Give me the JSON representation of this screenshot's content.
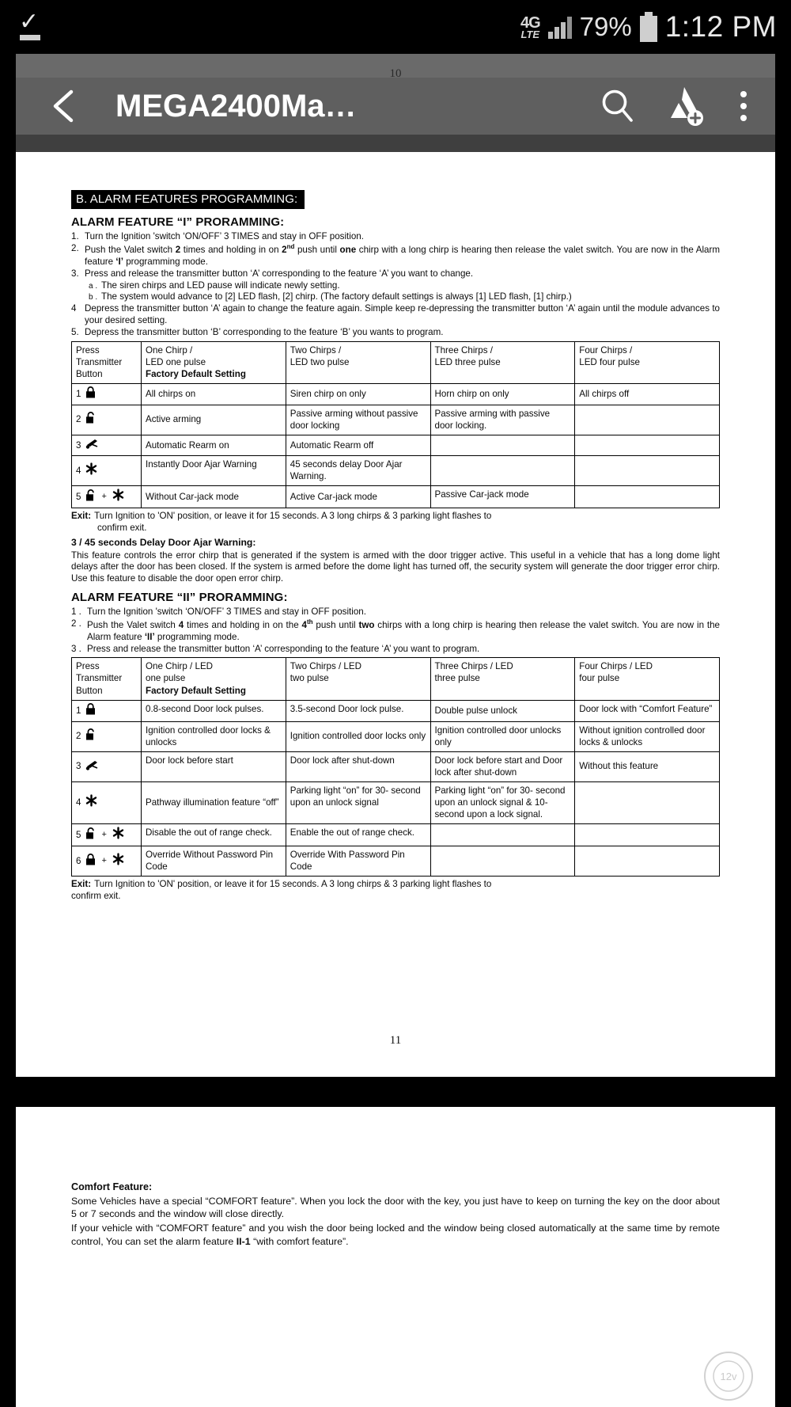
{
  "statusbar": {
    "download_icon": "download-complete-icon",
    "network_type_line1": "4G",
    "network_type_line2": "LTE",
    "signal_icon": "signal-bars-icon",
    "battery_percent": "79%",
    "battery_icon": "battery-icon",
    "time": "1:12 PM"
  },
  "appbar": {
    "back_icon": "back-arrow-icon",
    "title": "MEGA2400Ma…",
    "search_icon": "search-icon",
    "add_to_drive_icon": "drive-add-icon",
    "overflow_icon": "more-options-icon",
    "page_indicator": "10"
  },
  "doc": {
    "section_band": "B. ALARM FEATURES PROGRAMMING:",
    "feature1": {
      "heading": "ALARM FEATURE “I” PRORAMMING:",
      "steps": [
        {
          "num": "1.",
          "text": "Turn the Ignition 'switch ‘ON/OFF’ 3 TIMES and stay in OFF position."
        },
        {
          "num": "2.",
          "text_a": "Push the Valet switch ",
          "bold_a": "2",
          "text_b": " times and holding in on ",
          "bold_b": "2",
          "sup_b": "nd",
          "text_c": " push until ",
          "bold_c": "one",
          "text_d": " chirp with a long chirp is hearing then release the valet switch. You are now in the Alarm feature ",
          "bold_d": "‘I’",
          "text_e": " programming mode."
        },
        {
          "num": "3.",
          "text": "Press and release the transmitter button ‘A’ corresponding to the feature ‘A’ you want to change."
        }
      ],
      "substeps": [
        {
          "num": "a .",
          "text": "The siren chirps and LED pause will indicate newly setting."
        },
        {
          "num": "b .",
          "text": "The system would advance to [2] LED flash, [2] chirp. (The factory default settings is always [1] LED flash, [1] chirp.)"
        }
      ],
      "steps2": [
        {
          "num": "4",
          "text": "Depress the transmitter button ‘A’ again to change the feature again. Simple keep re-depressing the transmitter button ‘A’ again until the module advances to your desired setting."
        },
        {
          "num": "5.",
          "text": "Depress the transmitter button ‘B’ corresponding to the feature ‘B’ you wants to program."
        }
      ],
      "table": {
        "headers": [
          {
            "l1": "Press",
            "l2": "Transmitter",
            "l3": "Button",
            "bold3": ""
          },
          {
            "l1": "One Chirp /",
            "l2": "LED one pulse",
            "l3": "Factory Default Setting",
            "bold3": "yes"
          },
          {
            "l1": "Two Chirps /",
            "l2": "LED two pulse",
            "l3": "",
            "bold3": ""
          },
          {
            "l1": "Three Chirps /",
            "l2": "LED three pulse",
            "l3": "",
            "bold3": ""
          },
          {
            "l1": "Four Chirps /",
            "l2": "LED four pulse",
            "l3": "",
            "bold3": ""
          }
        ],
        "rows": [
          {
            "num": "1",
            "icons": [
              "lock"
            ],
            "cells": [
              "All chirps on",
              "Siren chirp on only",
              "Horn chirp on only",
              "All chirps off"
            ]
          },
          {
            "num": "2",
            "icons": [
              "unlock"
            ],
            "cells": [
              "Active arming",
              "Passive arming without passive door locking",
              "Passive arming with passive door locking.",
              ""
            ]
          },
          {
            "num": "3",
            "icons": [
              "trunk"
            ],
            "cells": [
              "Automatic Rearm on",
              "Automatic Rearm off",
              "",
              ""
            ]
          },
          {
            "num": "4",
            "icons": [
              "star"
            ],
            "cells": [
              "Instantly Door Ajar Warning",
              "45 seconds delay Door Ajar Warning.",
              "",
              ""
            ]
          },
          {
            "num": "5",
            "icons": [
              "unlock",
              "plus",
              "star"
            ],
            "cells": [
              "Without Car-jack mode",
              "Active Car-jack mode",
              "Passive Car-jack mode",
              ""
            ]
          }
        ]
      },
      "exit_label": "Exit:",
      "exit_text": "Turn Ignition to 'ON' position, or leave it for 15 seconds. A 3 long chirps & 3 parking light flashes to",
      "exit_text2": "confirm exit.",
      "note_heading": "3 / 45 seconds Delay Door Ajar Warning:",
      "note_body": "This feature controls the error chirp that is generated if the system is armed with the door trigger active. This useful in a vehicle that has a long dome light delays after the door has been closed. If the system is armed before the dome light has turned off, the security system will generate the door trigger error chirp. Use this feature to disable the door open error chirp."
    },
    "feature2": {
      "heading": "ALARM FEATURE “II” PRORAMMING:",
      "steps": [
        {
          "num": "1 .",
          "text": "Turn the Ignition 'switch ‘ON/OFF’ 3 TIMES and stay in OFF position."
        },
        {
          "num": "2 .",
          "text_a": "Push the Valet switch ",
          "bold_a": "4",
          "text_b": " times and holding in on the ",
          "bold_b": "4",
          "sup_b": "th",
          "text_c": " push until ",
          "bold_c": "two",
          "text_d": " chirps with a long chirp is hearing then release the valet switch. You are now in the Alarm feature ",
          "bold_d": "‘II’",
          "text_e": " programming mode."
        },
        {
          "num": "3 .",
          "text": "Press and release the transmitter button ‘A’ corresponding to the feature ‘A’ you want to program."
        }
      ],
      "table": {
        "headers": [
          {
            "l1": "Press",
            "l2": "Transmitter",
            "l3": "Button",
            "bold3": ""
          },
          {
            "l1": "One Chirp / LED",
            "l2": "one pulse",
            "l3": "Factory Default Setting",
            "bold3": "yes"
          },
          {
            "l1": "Two Chirps / LED",
            "l2": "two pulse",
            "l3": "",
            "bold3": ""
          },
          {
            "l1": "Three Chirps / LED",
            "l2": "three pulse",
            "l3": "",
            "bold3": ""
          },
          {
            "l1": "Four Chirps / LED",
            "l2": "four pulse",
            "l3": "",
            "bold3": ""
          }
        ],
        "rows": [
          {
            "num": "1",
            "icons": [
              "lock"
            ],
            "cells": [
              "0.8-second Door lock pulses.",
              "3.5-second Door lock pulse.",
              "Double pulse unlock",
              "Door lock with “Comfort Feature”"
            ]
          },
          {
            "num": "2",
            "icons": [
              "unlock"
            ],
            "cells": [
              "Ignition controlled door locks & unlocks",
              "Ignition controlled door locks only",
              "Ignition controlled door unlocks only",
              "Without ignition controlled door locks & unlocks"
            ]
          },
          {
            "num": "3",
            "icons": [
              "trunk"
            ],
            "cells": [
              "Door lock before start",
              "Door lock after shut-down",
              "Door lock before start and Door lock after shut-down",
              "Without this feature"
            ]
          },
          {
            "num": "4",
            "icons": [
              "star"
            ],
            "cells": [
              "Pathway illumination feature “off”",
              "Parking light “on” for 30- second upon an unlock signal",
              "Parking light “on” for 30- second upon an unlock signal & 10-second upon a lock signal.",
              ""
            ]
          },
          {
            "num": "5",
            "icons": [
              "unlock",
              "plus",
              "star"
            ],
            "cells": [
              "Disable the out of range check.",
              "Enable the out of range check.",
              "",
              ""
            ]
          },
          {
            "num": "6",
            "icons": [
              "lock",
              "plus",
              "star"
            ],
            "cells": [
              "Override Without Password Pin Code",
              "Override With Password Pin Code",
              "",
              ""
            ]
          }
        ]
      },
      "exit_label": "Exit:",
      "exit_text": "Turn Ignition to 'ON' position, or leave it for 15 seconds. A 3 long chirps & 3 parking light flashes to",
      "exit_text2": "confirm exit."
    },
    "page_number": "11"
  },
  "doc_next": {
    "comfort_heading": "Comfort Feature:",
    "comfort_p1": "Some Vehicles have a special “COMFORT feature”. When you lock the door with the key, you just have to keep on turning the key on the door about 5 or 7 seconds and the window will close directly.",
    "comfort_p2_a": "If your vehicle with “COMFORT feature” and you wish the door being locked and the window being closed automatically at the same time by remote control, You can set the alarm feature ",
    "comfort_p2_bold": "II-1",
    "comfort_p2_b": " “with comfort feature”."
  },
  "colors": {
    "status_bar_bg": "#000000",
    "app_bar_bg": "#5f5f5f",
    "page_strip_bg": "#6a6a6a",
    "page_bg": "#ffffff",
    "text": "#0b0b0b"
  }
}
